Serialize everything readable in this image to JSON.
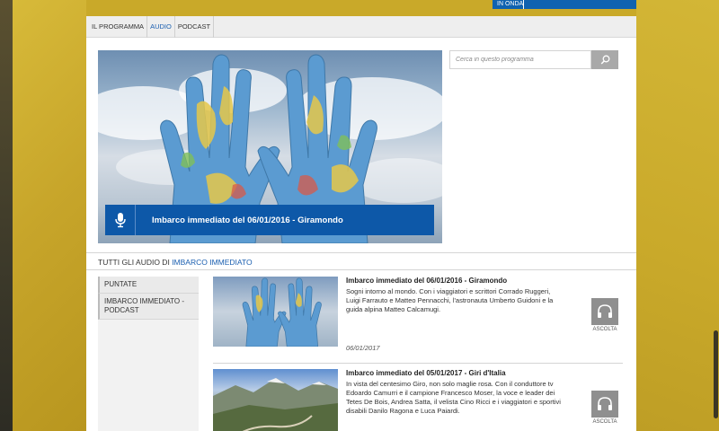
{
  "header": {
    "on_air_label": "IN ONDA"
  },
  "subnav": {
    "tabs": [
      "IL PROGRAMMA",
      "AUDIO",
      "PODCAST"
    ],
    "active": "AUDIO"
  },
  "hero": {
    "title": "Imbarco immediato del 06/01/2016 - Giramondo",
    "icon": "microphone-icon"
  },
  "search": {
    "placeholder": "Cerca in questo programma",
    "icon": "search-icon"
  },
  "section": {
    "prefix": "TUTTI GLI AUDIO DI",
    "program": "IMBARCO IMMEDIATO"
  },
  "side_menu": {
    "items": [
      "PUNTATE",
      "IMBARCO IMMEDIATO - PODCAST"
    ]
  },
  "episodes": [
    {
      "title": "Imbarco immediato del 06/01/2016 - Giramondo",
      "description": "Sogni intorno al mondo. Con i viaggiatori e scrittori Corrado Ruggeri, Luigi Farrauto e Matteo Pennacchi, l'astronauta Umberto Guidoni e la guida alpina Matteo Calcamugi.",
      "date": "06/01/2017",
      "listen_label": "ASCOLTA",
      "listen_icon": "headphones-icon"
    },
    {
      "title": "Imbarco immediato del 05/01/2017 - Giri d'Italia",
      "description": "In vista del centesimo Giro, non solo maglie rosa. Con il conduttore tv Edoardo Camurri e il campione Francesco Moser, la voce e leader dei Tetes De Bois, Andrea Satta, il velista Cino Ricci e i viaggiatori e sportivi disabili Danilo Ragona e Luca Paiardi.",
      "date": "",
      "listen_label": "ASCOLTA",
      "listen_icon": "headphones-icon"
    }
  ],
  "colors": {
    "brand_blue": "#0d58a8",
    "link_blue": "#1b5fb0",
    "background_yellow": "#c9a929"
  }
}
